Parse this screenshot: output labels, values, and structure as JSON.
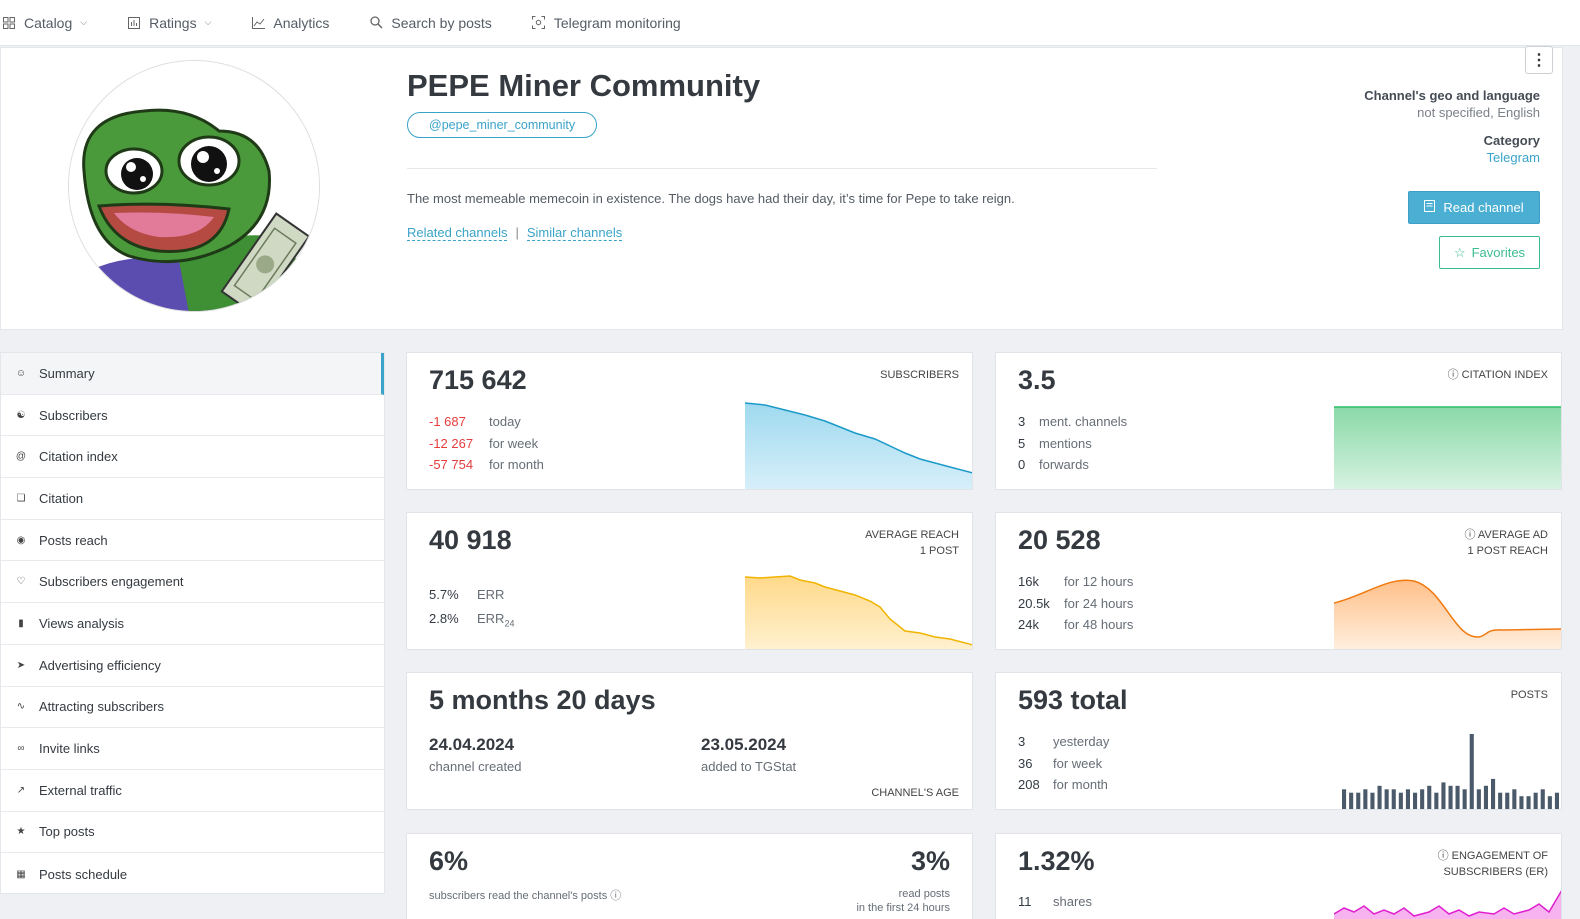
{
  "nav": {
    "items": [
      {
        "label": "Catalog",
        "icon": "grid-icon",
        "dropdown": true
      },
      {
        "label": "Ratings",
        "icon": "ratings-icon",
        "dropdown": true
      },
      {
        "label": "Analytics",
        "icon": "chart-line-icon",
        "dropdown": false
      },
      {
        "label": "Search by posts",
        "icon": "search-icon",
        "dropdown": false
      },
      {
        "label": "Telegram monitoring",
        "icon": "monitor-icon",
        "dropdown": false
      }
    ]
  },
  "channel": {
    "title": "PEPE Miner Community",
    "username": "@pepe_miner_community",
    "description": "The most memeable memecoin in existence. The dogs have had their day, it’s time for Pepe to take reign.",
    "related_label": "Related channels",
    "link_separator": "|",
    "similar_label": "Similar channels",
    "geo_label": "Channel's geo and language",
    "geo_value": "not specified, English",
    "category_label": "Category",
    "category_value": "Telegram",
    "read_button": "Read channel",
    "favorites_button": "Favorites",
    "more_menu": "⋮"
  },
  "sidebar": {
    "items": [
      {
        "label": "Summary",
        "icon": "summary-icon",
        "active": true
      },
      {
        "label": "Subscribers",
        "icon": "users-icon"
      },
      {
        "label": "Citation index",
        "icon": "at-icon"
      },
      {
        "label": "Citation",
        "icon": "citation-icon"
      },
      {
        "label": "Posts reach",
        "icon": "eye-icon"
      },
      {
        "label": "Subscribers engagement",
        "icon": "engagement-icon"
      },
      {
        "label": "Views analysis",
        "icon": "bar-chart-icon"
      },
      {
        "label": "Advertising efficiency",
        "icon": "rocket-icon"
      },
      {
        "label": "Attracting subscribers",
        "icon": "trend-icon"
      },
      {
        "label": "Invite links",
        "icon": "link-icon"
      },
      {
        "label": "External traffic",
        "icon": "share-arrow-icon"
      },
      {
        "label": "Top posts",
        "icon": "thumbs-up-icon"
      },
      {
        "label": "Posts schedule",
        "icon": "calendar-icon"
      }
    ]
  },
  "cards": {
    "subscribers": {
      "value": "715 642",
      "label": "SUBSCRIBERS",
      "rows": [
        {
          "n": "-1 687",
          "t": "today"
        },
        {
          "n": "-12 267",
          "t": "for week"
        },
        {
          "n": "-57 754",
          "t": "for month"
        }
      ]
    },
    "citation": {
      "value": "3.5",
      "label": "CITATION INDEX",
      "rows": [
        {
          "n": "3",
          "t": "ment. channels"
        },
        {
          "n": "5",
          "t": "mentions"
        },
        {
          "n": "0",
          "t": "forwards"
        }
      ]
    },
    "reach": {
      "value": "40 918",
      "label_1": "AVERAGE REACH",
      "label_2": "1 POST",
      "rows": [
        {
          "n": "5.7%",
          "t": "ERR"
        },
        {
          "n": "2.8%",
          "t": "ERR",
          "sub": "24"
        }
      ]
    },
    "ad_reach": {
      "value": "20 528",
      "label_1": "AVERAGE AD",
      "label_2": "1 POST REACH",
      "rows": [
        {
          "n": "16k",
          "t": "for 12 hours"
        },
        {
          "n": "20.5k",
          "t": "for 24 hours"
        },
        {
          "n": "24k",
          "t": "for 48 hours"
        }
      ]
    },
    "age": {
      "value": "5 months 20 days",
      "created_date": "24.04.2024",
      "created_label": "channel created",
      "added_date": "23.05.2024",
      "added_label": "added to TGStat",
      "label": "CHANNEL'S AGE"
    },
    "posts": {
      "value": "593 total",
      "label": "POSTS",
      "rows": [
        {
          "n": "3",
          "t": "yesterday"
        },
        {
          "n": "36",
          "t": "for week"
        },
        {
          "n": "208",
          "t": "for month"
        }
      ],
      "bars": [
        6,
        5,
        5,
        6,
        5,
        7,
        6,
        6,
        5,
        6,
        5,
        6,
        7,
        5,
        8,
        7,
        7,
        6,
        22,
        6,
        7,
        9,
        5,
        5,
        6,
        4,
        4,
        5,
        6,
        4,
        5
      ]
    },
    "read_pct": {
      "value": "6%",
      "text": "subscribers read the channel's posts",
      "value_2": "3%",
      "text_2a": "read posts",
      "text_2b": "in the first 24 hours"
    },
    "er": {
      "value": "1.32%",
      "label_1": "ENGAGEMENT OF",
      "label_2": "SUBSCRIBERS (ER)",
      "rows": [
        {
          "n": "11",
          "t": "shares"
        }
      ]
    }
  },
  "chart_colors": {
    "subscribers": "#1b9ac9",
    "citation": "#2ebd6b",
    "reach": "#f0b400",
    "ad_reach": "#f07a10",
    "posts": "#4a5a6a",
    "er": "#e020d0"
  }
}
